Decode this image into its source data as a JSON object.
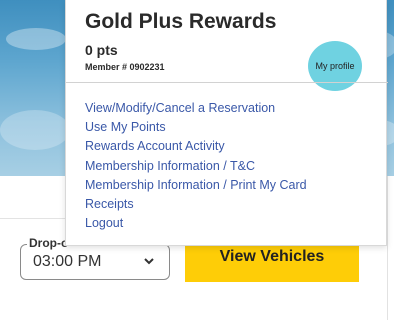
{
  "rewards": {
    "title": "Gold Plus Rewards",
    "points": "0 pts",
    "member": "Member # 0902231",
    "profile_label": "My profile"
  },
  "menu": {
    "items": [
      {
        "label": "View/Modify/Cancel a Reservation"
      },
      {
        "label": "Use My Points"
      },
      {
        "label": "Rewards Account Activity"
      },
      {
        "label": "Membership Information / T&C"
      },
      {
        "label": "Membership Information / Print My Card"
      },
      {
        "label": "Receipts"
      },
      {
        "label": "Logout"
      }
    ]
  },
  "booking": {
    "dropoff_label": "Drop-o",
    "dropoff_time": "03:00 PM",
    "view_button": "View Vehicles"
  },
  "colors": {
    "link": "#3a58a8",
    "profile_bubble": "#6fd2e1",
    "primary_button": "#fecd07"
  },
  "icons": {
    "select_chevron": "chevron-down-icon"
  }
}
